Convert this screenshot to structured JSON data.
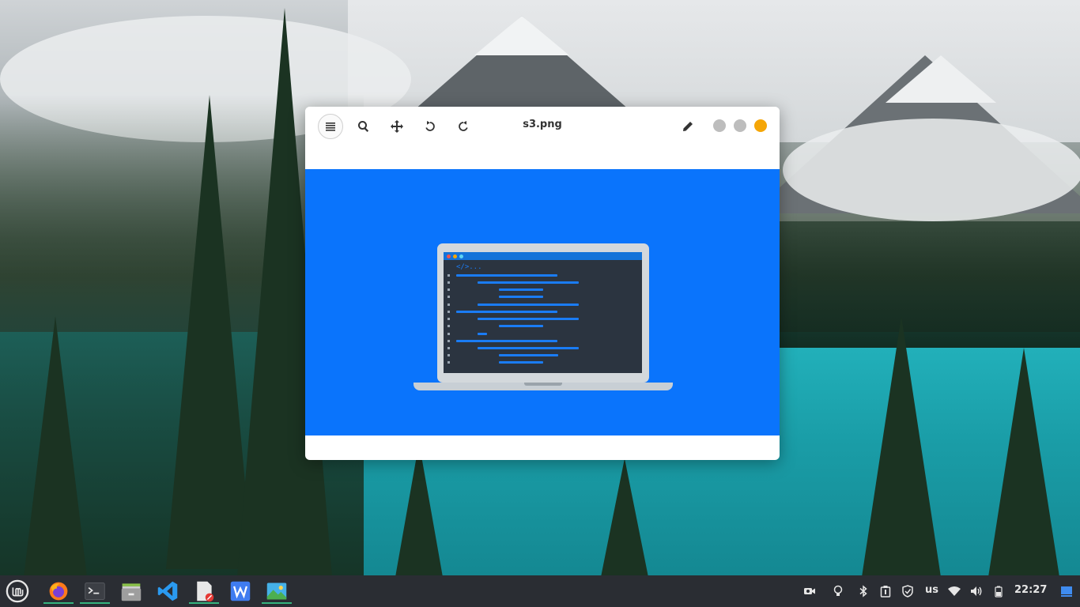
{
  "window": {
    "title": "s3.png",
    "toolbar": {
      "menu_icon": "menu-icon",
      "zoom_icon": "search-icon",
      "move_icon": "move-icon",
      "rotate_left_icon": "rotate-left-icon",
      "rotate_right_icon": "rotate-right-icon",
      "edit_icon": "pencil-icon"
    },
    "controls": [
      {
        "name": "minimize",
        "color": "#bdbdbd"
      },
      {
        "name": "maximize",
        "color": "#bdbdbd"
      },
      {
        "name": "close",
        "color": "#f5a607"
      }
    ],
    "image": {
      "background": "#0a74fc",
      "code_tag": "</>..."
    }
  },
  "taskbar": {
    "apps": [
      {
        "name": "menu",
        "icon": "linux-mint-icon"
      },
      {
        "name": "firefox",
        "icon": "firefox-icon",
        "active": true
      },
      {
        "name": "terminal",
        "icon": "terminal-icon",
        "active": true
      },
      {
        "name": "files",
        "icon": "file-manager-icon"
      },
      {
        "name": "vscode",
        "icon": "vscode-icon"
      },
      {
        "name": "text-editor",
        "icon": "text-editor-icon",
        "active": true
      },
      {
        "name": "wps-writer",
        "icon": "writer-icon"
      },
      {
        "name": "image-viewer",
        "icon": "image-viewer-icon",
        "active": true
      }
    ],
    "tray": {
      "keyboard_layout": "us",
      "clock": "22:27"
    }
  }
}
